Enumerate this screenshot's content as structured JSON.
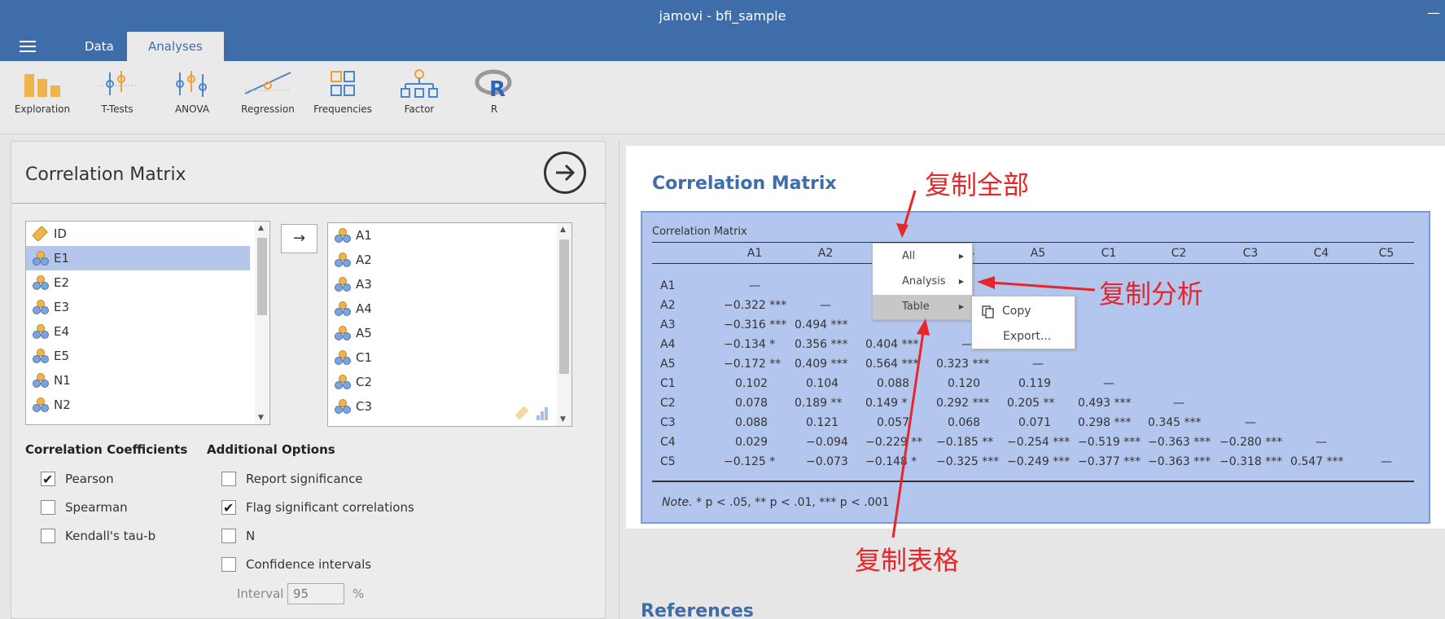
{
  "window": {
    "title": "jamovi - bfi_sample",
    "minimize": "—"
  },
  "tabs": {
    "data": "Data",
    "analyses": "Analyses"
  },
  "ribbon": {
    "exploration": "Exploration",
    "ttests": "T-Tests",
    "anova": "ANOVA",
    "regression": "Regression",
    "frequencies": "Frequencies",
    "factor": "Factor",
    "r": "R"
  },
  "panel": {
    "title": "Correlation Matrix",
    "source_vars": [
      "ID",
      "E1",
      "E2",
      "E3",
      "E4",
      "E5",
      "N1",
      "N2"
    ],
    "target_vars": [
      "A1",
      "A2",
      "A3",
      "A4",
      "A5",
      "C1",
      "C2",
      "C3"
    ],
    "move_label": "→",
    "coef_heading": "Correlation Coefficients",
    "coefs": [
      {
        "label": "Pearson",
        "checked": true
      },
      {
        "label": "Spearman",
        "checked": false
      },
      {
        "label": "Kendall's tau-b",
        "checked": false
      }
    ],
    "add_heading": "Additional Options",
    "add_opts": [
      {
        "label": "Report significance",
        "checked": false
      },
      {
        "label": "Flag significant correlations",
        "checked": true
      },
      {
        "label": "N",
        "checked": false
      },
      {
        "label": "Confidence intervals",
        "checked": false
      }
    ],
    "interval_label": "Interval",
    "interval_value": "95",
    "interval_unit": "%"
  },
  "results": {
    "title": "Correlation Matrix",
    "table_caption": "Correlation Matrix",
    "columns": [
      "A1",
      "A2",
      "A3",
      "A4",
      "A5",
      "C1",
      "C2",
      "C3",
      "C4",
      "C5"
    ],
    "rows": [
      {
        "name": "A1",
        "cells": [
          "—"
        ]
      },
      {
        "name": "A2",
        "cells": [
          "−0.322 ***",
          "—"
        ]
      },
      {
        "name": "A3",
        "cells": [
          "−0.316 ***",
          "0.494 ***"
        ]
      },
      {
        "name": "A4",
        "cells": [
          "−0.134 *",
          "0.356 ***",
          "0.404 ***",
          "—"
        ]
      },
      {
        "name": "A5",
        "cells": [
          "−0.172 **",
          "0.409 ***",
          "0.564 ***",
          "0.323 ***",
          "—"
        ]
      },
      {
        "name": "C1",
        "cells": [
          "0.102",
          "0.104",
          "0.088",
          "0.120",
          "0.119",
          "—"
        ]
      },
      {
        "name": "C2",
        "cells": [
          "0.078",
          "0.189 **",
          "0.149 *",
          "0.292 ***",
          "0.205 **",
          "0.493 ***",
          "—"
        ]
      },
      {
        "name": "C3",
        "cells": [
          "0.088",
          "0.121",
          "0.057",
          "0.068",
          "0.071",
          "0.298 ***",
          "0.345 ***",
          "—"
        ]
      },
      {
        "name": "C4",
        "cells": [
          "0.029",
          "−0.094",
          "−0.229 **",
          "−0.185 **",
          "−0.254 ***",
          "−0.519 ***",
          "−0.363 ***",
          "−0.280 ***",
          "—"
        ]
      },
      {
        "name": "C5",
        "cells": [
          "−0.125 *",
          "−0.073",
          "−0.148 *",
          "−0.325 ***",
          "−0.249 ***",
          "−0.377 ***",
          "−0.363 ***",
          "−0.318 ***",
          "0.547 ***",
          "—"
        ]
      }
    ],
    "note_label": "Note.",
    "note_text": " * p < .05, ** p < .01, *** p < .001",
    "references": "References"
  },
  "context_menu": {
    "items": [
      "All",
      "Analysis",
      "Table"
    ],
    "submenu": [
      "Copy",
      "Export..."
    ]
  },
  "annotations": {
    "copy_all": "复制全部",
    "copy_analysis": "复制分析",
    "copy_table": "复制表格"
  },
  "colors": {
    "brand": "#3e6da9",
    "selection": "#b3c6ee",
    "annotation": "#e8262a"
  }
}
